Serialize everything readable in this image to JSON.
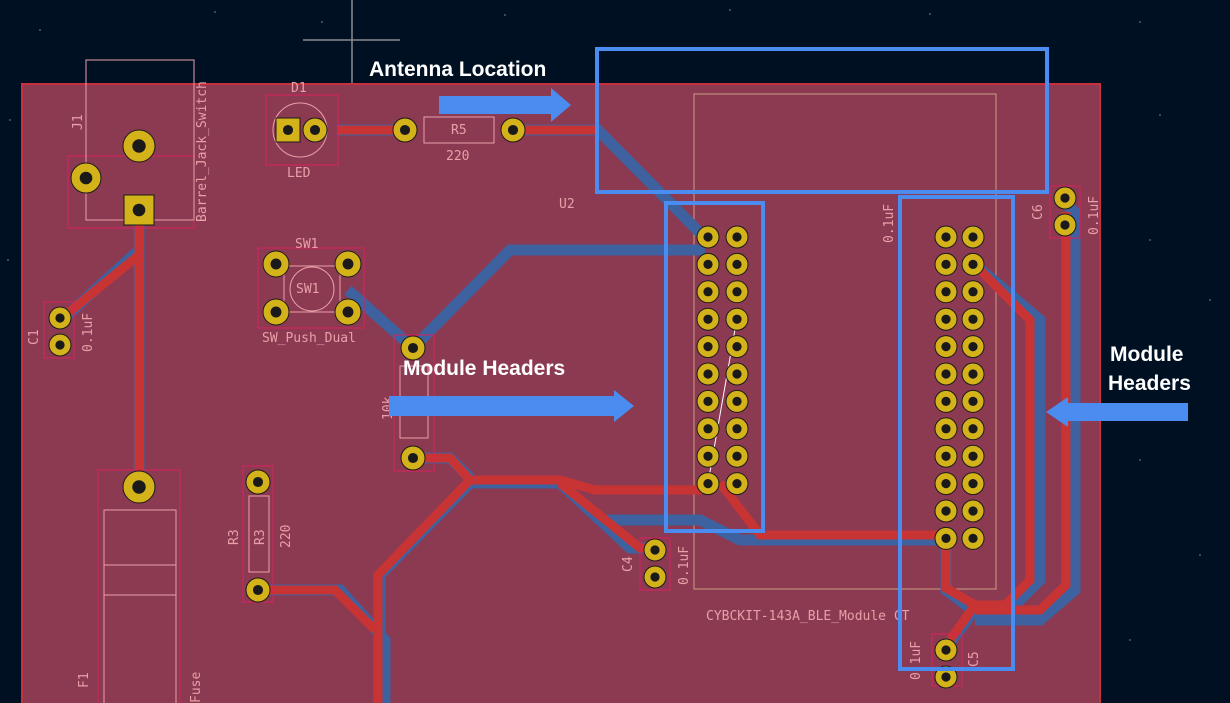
{
  "colors": {
    "background": "#001023",
    "board": "#8b3a52",
    "board_edge": "#c8303c",
    "track_front": "#c83434",
    "track_back": "#3e62a0",
    "pad": "#d4b21a",
    "hole": "#1a1a1a",
    "silk": "#e8a0a8",
    "courtyard": "#d8205c",
    "fab": "#c8a080",
    "callout": "#4a8cf0",
    "annotation_text": "#ffffff"
  },
  "annotations": {
    "antenna": "Antenna Location",
    "headers_center": "Module Headers",
    "headers_right_line1": "Module",
    "headers_right_line2": "Headers"
  },
  "refdes": {
    "j1": "J1",
    "j1_value": "Barrel_Jack_Switch",
    "d1": "D1",
    "d1_value": "LED",
    "r5": "R5",
    "r5_value": "220",
    "u2": "U2",
    "u2_value": "CYBCKIT-143A_BLE_Module CT",
    "sw1_top": "SW1",
    "sw1_inner": "SW1",
    "sw1_value": "SW_Push_Dual",
    "c1": "C1",
    "c1_value": "0.1uF",
    "r_pullup_value": "10k",
    "r3": "R3",
    "r3_value": "220",
    "c4": "C4",
    "c4_value": "0.1uF",
    "c5": "C5",
    "c5_value": "0.1uF",
    "c6": "C6",
    "c6_value": "0.1uF",
    "u2_cap_value": "0.1uF",
    "f1": "F1",
    "f1_value": "Fuse"
  }
}
